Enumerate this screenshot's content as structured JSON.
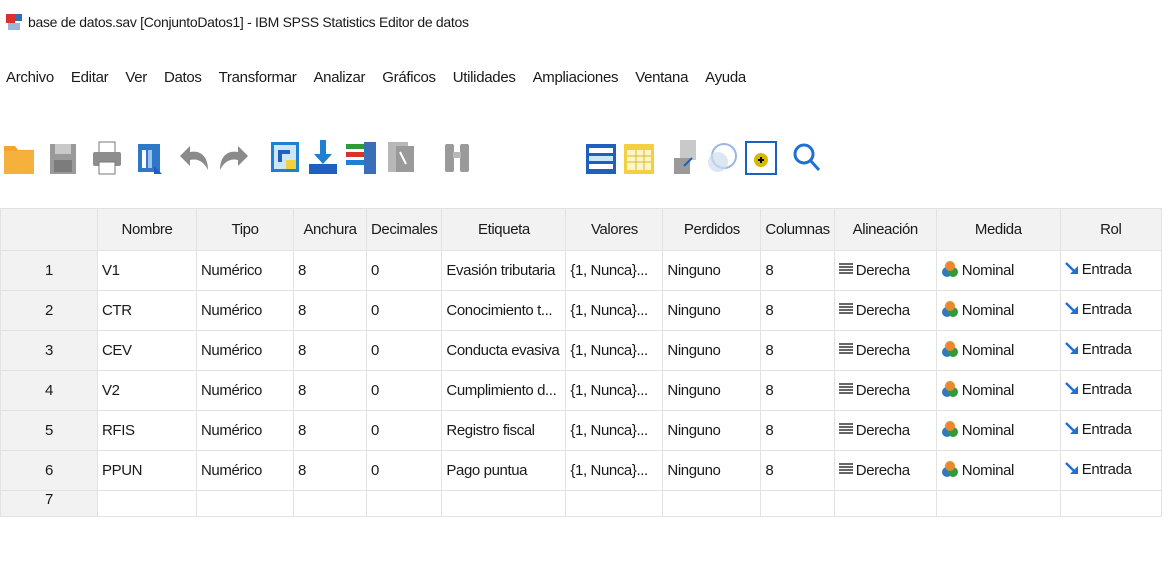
{
  "window": {
    "title": "base de datos.sav [ConjuntoDatos1] - IBM SPSS Statistics Editor de datos"
  },
  "menu": [
    "Archivo",
    "Editar",
    "Ver",
    "Datos",
    "Transformar",
    "Analizar",
    "Gráficos",
    "Utilidades",
    "Ampliaciones",
    "Ventana",
    "Ayuda"
  ],
  "toolbar": {
    "buttons": [
      "open-folder",
      "save",
      "print",
      "dialog-recall",
      "undo",
      "redo",
      "go-to-case",
      "go-to-variable",
      "variables",
      "run-descriptives",
      "find",
      "split-file",
      "select-cases",
      "weight-cases",
      "value-labels",
      "use-variable-sets",
      "search"
    ]
  },
  "table": {
    "headers": [
      "",
      "Nombre",
      "Tipo",
      "Anchura",
      "Decimales",
      "Etiqueta",
      "Valores",
      "Perdidos",
      "Columnas",
      "Alineación",
      "Medida",
      "Rol"
    ],
    "rows": [
      [
        "1",
        "V1",
        "Numérico",
        "8",
        "0",
        "Evasión tributaria",
        "{1, Nunca}...",
        "Ninguno",
        "8",
        "Derecha",
        "Nominal",
        "Entrada"
      ],
      [
        "2",
        "CTR",
        "Numérico",
        "8",
        "0",
        " Conocimiento t...",
        "{1, Nunca}...",
        "Ninguno",
        "8",
        "Derecha",
        "Nominal",
        "Entrada"
      ],
      [
        "3",
        "CEV",
        "Numérico",
        "8",
        "0",
        "Conducta evasiva",
        "{1, Nunca}...",
        "Ninguno",
        "8",
        "Derecha",
        "Nominal",
        "Entrada"
      ],
      [
        "4",
        "V2",
        "Numérico",
        "8",
        "0",
        "Cumplimiento d...",
        "{1, Nunca}...",
        "Ninguno",
        "8",
        "Derecha",
        "Nominal",
        "Entrada"
      ],
      [
        "5",
        "RFIS",
        "Numérico",
        "8",
        "0",
        "Registro fiscal",
        "{1, Nunca}...",
        "Ninguno",
        "8",
        "Derecha",
        "Nominal",
        "Entrada"
      ],
      [
        "6",
        "PPUN",
        "Numérico",
        "8",
        "0",
        "Pago puntua",
        "{1, Nunca}...",
        "Ninguno",
        "8",
        "Derecha",
        "Nominal",
        "Entrada"
      ]
    ],
    "empty_row_number": "7"
  },
  "colors": {
    "header_bg": "#f2f2f2",
    "grid_line": "#e2e2e2",
    "accent_blue": "#1f5fbf",
    "folder": "#f2a530"
  }
}
